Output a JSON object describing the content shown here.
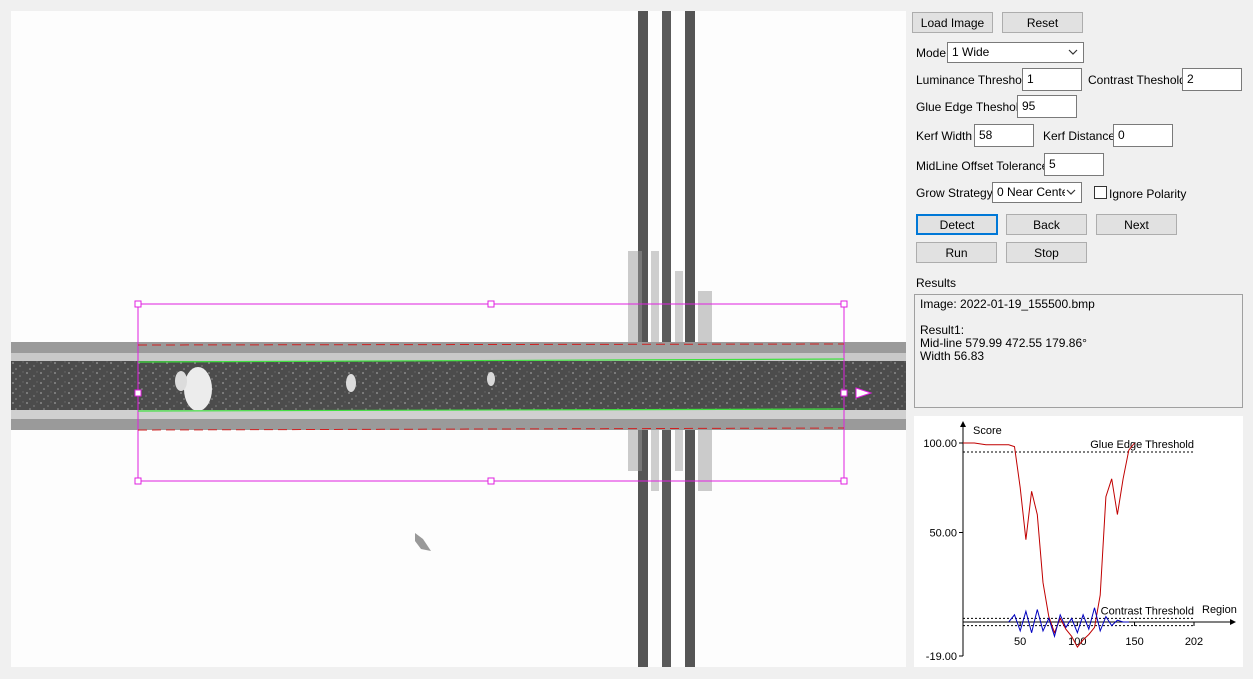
{
  "toolbar": {
    "load_label": "Load Image",
    "reset_label": "Reset"
  },
  "params": {
    "mode_label": "Mode",
    "mode_value": "1 Wide",
    "lum_label": "Luminance Threshold",
    "lum_value": "1",
    "contrast_label": "Contrast Theshold",
    "contrast_value": "2",
    "glue_label": "Glue Edge Theshold",
    "glue_value": "95",
    "kerf_width_label": "Kerf Width",
    "kerf_width_value": "58",
    "kerf_dist_label": "Kerf Distance",
    "kerf_dist_value": "0",
    "midline_label": "MidLine Offset Tolerance",
    "midline_value": "5",
    "grow_label": "Grow Strategy",
    "grow_value": "0 Near Center",
    "ignore_label": "Ignore Polarity",
    "ignore_checked": false
  },
  "actions": {
    "detect": "Detect",
    "back": "Back",
    "next": "Next",
    "run": "Run",
    "stop": "Stop"
  },
  "results": {
    "title": "Results",
    "lines": [
      "Image: 2022-01-19_155500.bmp",
      "",
      "Result1:",
      "Mid-line 579.99 472.55 179.86°",
      "Width 56.83"
    ]
  },
  "colors": {
    "roi": "#e020e0",
    "fit_line": "#40e040",
    "edge_dash": "#d02020",
    "score_series": "#c00000",
    "contrast_series": "#0000c0",
    "focus": "#0078d7"
  },
  "chart_data": {
    "type": "line",
    "xlabel": "Region",
    "ylabel": "Score",
    "xlim": [
      0,
      202
    ],
    "ylim": [
      -19,
      100
    ],
    "xticks": [
      "50",
      "100",
      "150",
      "202"
    ],
    "yticks": [
      "100.00",
      "50.00",
      "-19.00"
    ],
    "thresholds": [
      {
        "label": "Glue Edge Threshold",
        "y": 95
      },
      {
        "label": "Contrast Threshold",
        "y": 2
      }
    ],
    "series": [
      {
        "values_x": [
          0,
          10,
          20,
          40,
          45,
          50,
          55,
          60,
          65,
          70,
          75,
          80,
          85,
          90,
          95,
          100,
          105,
          110,
          115,
          120,
          125,
          130,
          135,
          140,
          145,
          150
        ],
        "values_y": [
          100,
          100,
          99,
          99,
          98,
          75,
          46,
          73,
          60,
          22,
          3,
          -6,
          2,
          -4,
          -8,
          -14,
          -10,
          -7,
          -3,
          15,
          70,
          80,
          60,
          80,
          96,
          100
        ]
      },
      {
        "values_x": [
          40,
          45,
          50,
          55,
          60,
          65,
          70,
          75,
          80,
          85,
          90,
          95,
          100,
          105,
          110,
          115,
          120,
          125,
          130,
          135,
          140,
          145
        ],
        "values_y": [
          0,
          4,
          -5,
          6,
          -6,
          7,
          -5,
          2,
          -8,
          4,
          -3,
          2,
          -6,
          4,
          -4,
          8,
          -5,
          3,
          -2,
          1,
          0,
          0
        ]
      }
    ]
  }
}
